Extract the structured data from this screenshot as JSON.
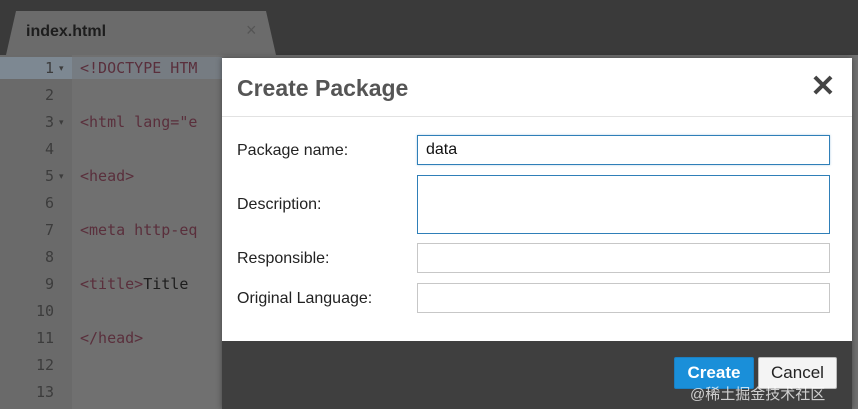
{
  "editor": {
    "tab_title": "index.html",
    "tab_close": "×",
    "lines": [
      {
        "num": "1",
        "fold": "▾",
        "code_tag": "<!DOCTYPE HTM",
        "code_txt": ""
      },
      {
        "num": "2",
        "fold": "",
        "code_tag": "",
        "code_txt": ""
      },
      {
        "num": "3",
        "fold": "▾",
        "code_tag": "<html lang=\"e",
        "code_txt": ""
      },
      {
        "num": "4",
        "fold": "",
        "code_tag": "",
        "code_txt": ""
      },
      {
        "num": "5",
        "fold": "▾",
        "code_tag": "<head>",
        "code_txt": ""
      },
      {
        "num": "6",
        "fold": "",
        "code_tag": "",
        "code_txt": ""
      },
      {
        "num": "7",
        "fold": "",
        "code_tag": "<meta http-eq",
        "code_txt": ""
      },
      {
        "num": "8",
        "fold": "",
        "code_tag": "",
        "code_txt": ""
      },
      {
        "num": "9",
        "fold": "",
        "code_tag": "<title>",
        "code_txt": "Title"
      },
      {
        "num": "10",
        "fold": "",
        "code_tag": "",
        "code_txt": ""
      },
      {
        "num": "11",
        "fold": "",
        "code_tag": "</head>",
        "code_txt": ""
      },
      {
        "num": "12",
        "fold": "",
        "code_tag": "",
        "code_txt": ""
      },
      {
        "num": "13",
        "fold": "",
        "code_tag": "",
        "code_txt": ""
      }
    ]
  },
  "dialog": {
    "title": "Create Package",
    "close_icon": "✕",
    "fields": {
      "package_name": {
        "label": "Package name:",
        "value": "data"
      },
      "description": {
        "label": "Description:",
        "value": ""
      },
      "responsible": {
        "label": "Responsible:",
        "value": ""
      },
      "original_language": {
        "label": "Original Language:",
        "value": ""
      }
    },
    "buttons": {
      "create": "Create",
      "cancel": "Cancel"
    }
  },
  "watermark": "@稀土掘金技术社区",
  "colors": {
    "accent": "#1a8fd9",
    "focus_border": "#2f7fb8",
    "footer": "#3f3f3f"
  }
}
